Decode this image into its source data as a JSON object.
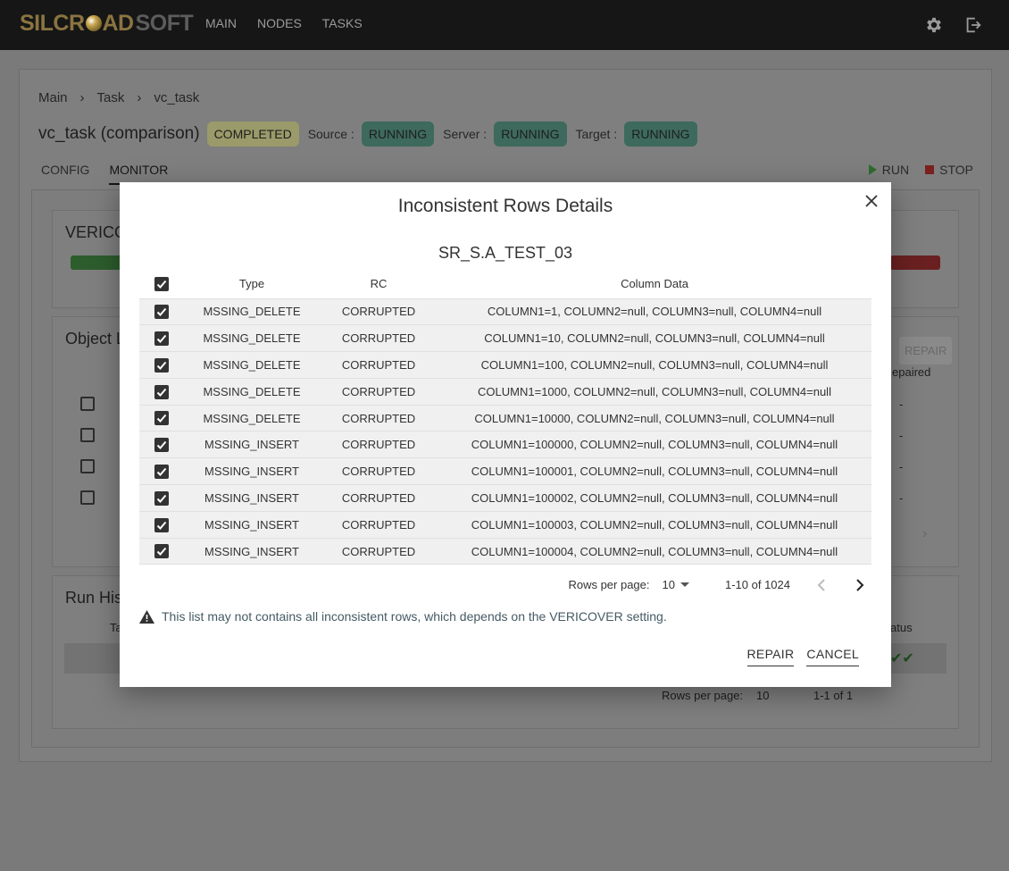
{
  "brand": {
    "logo_left": "SILCR",
    "logo_mid": "AD",
    "logo_right": "SOFT"
  },
  "nav": {
    "main": "MAIN",
    "nodes": "NODES",
    "tasks": "TASKS"
  },
  "breadcrumb": {
    "main": "Main",
    "task": "Task",
    "current": "vc_task"
  },
  "header": {
    "title": "vc_task (comparison)",
    "status": "COMPLETED",
    "source_label": "Source :",
    "source_status": "RUNNING",
    "server_label": "Server :",
    "server_status": "RUNNING",
    "target_label": "Target :",
    "target_status": "RUNNING"
  },
  "tabs": {
    "config": "CONFIG",
    "monitor": "MONITOR"
  },
  "actions": {
    "run": "RUN",
    "stop": "STOP"
  },
  "background": {
    "card1_title": "VERICO",
    "card2_title": "Object L",
    "card3_title": "Run His",
    "repair_btn": "REPAIR",
    "repaired_col": "epaired",
    "status_col": "atus",
    "ta_col": "Ta",
    "dash": "-",
    "rows_per_page": "Rows per page:",
    "rows_value": "10",
    "range": "1-1 of 1"
  },
  "modal": {
    "title": "Inconsistent Rows Details",
    "table_name": "SR_S.A_TEST_03",
    "columns": {
      "type": "Type",
      "rc": "RC",
      "data": "Column Data"
    },
    "rows": [
      {
        "type": "MSSING_DELETE",
        "rc": "CORRUPTED",
        "data": "COLUMN1=1, COLUMN2=null, COLUMN3=null, COLUMN4=null"
      },
      {
        "type": "MSSING_DELETE",
        "rc": "CORRUPTED",
        "data": "COLUMN1=10, COLUMN2=null, COLUMN3=null, COLUMN4=null"
      },
      {
        "type": "MSSING_DELETE",
        "rc": "CORRUPTED",
        "data": "COLUMN1=100, COLUMN2=null, COLUMN3=null, COLUMN4=null"
      },
      {
        "type": "MSSING_DELETE",
        "rc": "CORRUPTED",
        "data": "COLUMN1=1000, COLUMN2=null, COLUMN3=null, COLUMN4=null"
      },
      {
        "type": "MSSING_DELETE",
        "rc": "CORRUPTED",
        "data": "COLUMN1=10000, COLUMN2=null, COLUMN3=null, COLUMN4=null"
      },
      {
        "type": "MSSING_INSERT",
        "rc": "CORRUPTED",
        "data": "COLUMN1=100000, COLUMN2=null, COLUMN3=null, COLUMN4=null"
      },
      {
        "type": "MSSING_INSERT",
        "rc": "CORRUPTED",
        "data": "COLUMN1=100001, COLUMN2=null, COLUMN3=null, COLUMN4=null"
      },
      {
        "type": "MSSING_INSERT",
        "rc": "CORRUPTED",
        "data": "COLUMN1=100002, COLUMN2=null, COLUMN3=null, COLUMN4=null"
      },
      {
        "type": "MSSING_INSERT",
        "rc": "CORRUPTED",
        "data": "COLUMN1=100003, COLUMN2=null, COLUMN3=null, COLUMN4=null"
      },
      {
        "type": "MSSING_INSERT",
        "rc": "CORRUPTED",
        "data": "COLUMN1=100004, COLUMN2=null, COLUMN3=null, COLUMN4=null"
      }
    ],
    "rows_per_page_label": "Rows per page:",
    "rows_per_page_value": "10",
    "range": "1-10 of 1024",
    "warning": "This list may not contains all inconsistent rows, which depends on the VERICOVER setting.",
    "repair": "REPAIR",
    "cancel": "CANCEL"
  },
  "colors": {
    "overlay": "#7a7a7a",
    "running_chip": "#3d6a5d",
    "completed_chip": "#9a9a6a",
    "warning_text": "#455a64"
  }
}
